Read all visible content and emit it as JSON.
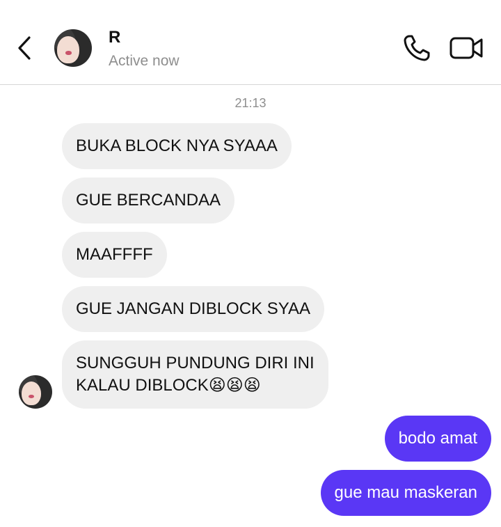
{
  "header": {
    "contact_name": "R",
    "status": "Active now",
    "icons": [
      "back-chevron-icon",
      "avatar",
      "phone-icon",
      "video-camera-icon"
    ]
  },
  "conversation": {
    "timestamp": "21:13",
    "incoming": [
      {
        "text": "BUKA BLOCK NYA SYAAA"
      },
      {
        "text": "GUE BERCANDAA"
      },
      {
        "text": "MAAFFFF"
      },
      {
        "text": "GUE JANGAN DIBLOCK SYAA"
      },
      {
        "text": "SUNGGUH PUNDUNG DIRI INI\nKALAU DIBLOCK😫😫😫"
      }
    ],
    "outgoing": [
      {
        "text": "bodo amat"
      },
      {
        "text": "gue mau maskeran"
      }
    ]
  },
  "colors": {
    "incoming_bubble": "#efefef",
    "outgoing_bubble": "#5a37f5",
    "muted_text": "#8e8e8e",
    "divider": "#d6d6d6"
  }
}
